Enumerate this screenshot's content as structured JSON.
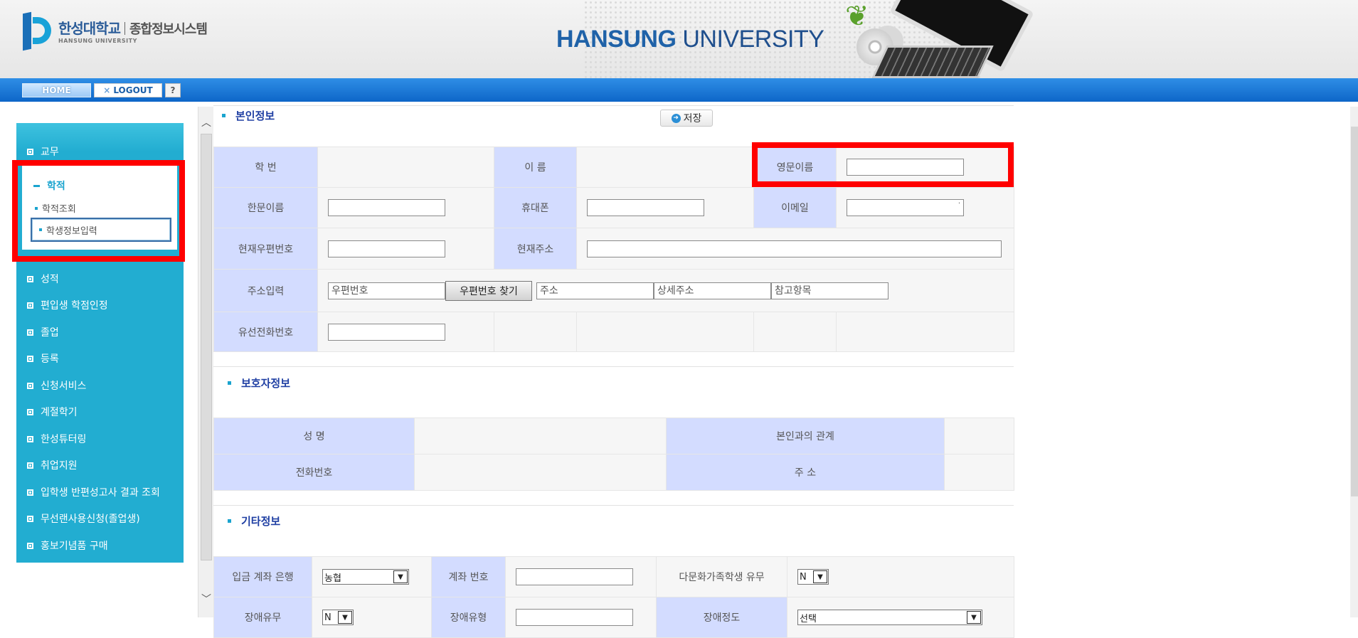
{
  "header": {
    "logo_korean": "한성대학교",
    "logo_system": "종합정보시스템",
    "logo_english": "HANSUNG UNIVERSITY",
    "brand_bold": "HANSUNG",
    "brand_rest": " UNIVERSITY"
  },
  "nav": {
    "home": "HOME",
    "logout_icon": "×",
    "logout": "LOGOUT",
    "help": "?"
  },
  "sidebar": {
    "items_top": [
      {
        "label": "교무"
      }
    ],
    "expanded": {
      "label": "학적",
      "sub": [
        {
          "label": "학적조회"
        },
        {
          "label": "학생정보입력"
        }
      ]
    },
    "items_bottom": [
      {
        "label": "성적"
      },
      {
        "label": "편입생 학점인정"
      },
      {
        "label": "졸업"
      },
      {
        "label": "등록"
      },
      {
        "label": "신청서비스"
      },
      {
        "label": "계절학기"
      },
      {
        "label": "한성튜터링"
      },
      {
        "label": "취업지원"
      },
      {
        "label": "입학생 반편성고사 결과 조회"
      },
      {
        "label": "무선랜사용신청(졸업생)"
      },
      {
        "label": "홍보기념품 구매"
      }
    ]
  },
  "content": {
    "save": "저장",
    "section_personal": {
      "title": "본인정보",
      "student_id": "학 번",
      "name": "이 름",
      "english_name": "영문이름",
      "chinese_name": "한문이름",
      "mobile": "휴대폰",
      "email": "이메일",
      "email_value": "·",
      "zip": "현재우편번호",
      "address": "현재주소",
      "address_input": "주소입력",
      "zip_placeholder": "우편번호",
      "find_zip": "우편번호 찾기",
      "addr_placeholder": "주소",
      "detail_placeholder": "상세주소",
      "ref_placeholder": "참고항목",
      "landline": "유선전화번호"
    },
    "section_guardian": {
      "title": "보호자정보",
      "name": "성    명",
      "relation": "본인과의 관계",
      "phone": "전화번호",
      "address": "주    소"
    },
    "section_other": {
      "title": "기타정보",
      "bank": "입금 계좌 은행",
      "bank_value": "농협",
      "account": "계좌 번호",
      "multicultural": "다문화가족학생 유무",
      "multicultural_value": "N",
      "disability": "장애유무",
      "disability_value": "N",
      "disability_type": "장애유형",
      "disability_degree": "장애정도",
      "disability_degree_value": "선택"
    }
  }
}
